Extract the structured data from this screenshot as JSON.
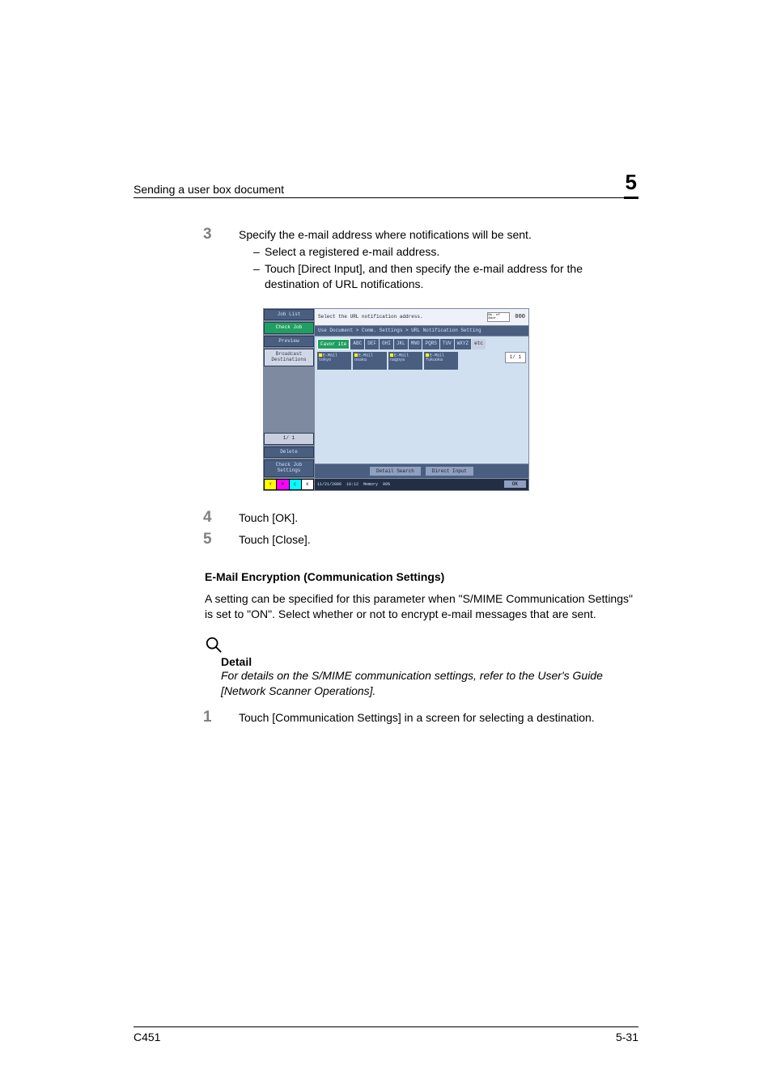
{
  "header": {
    "section_title": "Sending a user box document",
    "chapter_number": "5"
  },
  "steps": {
    "s3": {
      "num": "3",
      "text": "Specify the e-mail address where notifications will be sent.",
      "sub1": "Select a registered e-mail address.",
      "sub2": "Touch [Direct Input], and then specify the e-mail address for the destination of URL notifications."
    },
    "s4": {
      "num": "4",
      "text": "Touch [OK]."
    },
    "s5": {
      "num": "5",
      "text": "Touch [Close]."
    },
    "s1b": {
      "num": "1",
      "text": "Touch [Communication Settings] in a screen for selecting a destination."
    }
  },
  "encryption": {
    "heading": "E-Mail Encryption (Communication Settings)",
    "para": "A setting can be specified for this parameter when \"S/MIME Communication Settings\" is set to \"ON\". Select whether or not to encrypt e-mail messages that are sent."
  },
  "detail": {
    "heading": "Detail",
    "body": "For details on the S/MIME communication settings, refer to the User's Guide [Network Scanner Operations]."
  },
  "footer": {
    "model": "C451",
    "pageno": "5-31"
  },
  "screenshot": {
    "side": {
      "job_list": "Job List",
      "check_job": "Check Job",
      "preview": "Preview",
      "broadcast": "Broadcast\nDestinations",
      "page_ind": "1/ 1",
      "delete": "Delete",
      "check_job_settings": "Check Job\nSettings",
      "ymck": {
        "y": "Y",
        "m": "M",
        "c": "C",
        "k": "K"
      }
    },
    "top": {
      "prompt": "Select the URL notification address.",
      "counter_label": "No. of\nAddr.",
      "counter_value": "000"
    },
    "breadcrumb": "Use Document > Comm. Settings > URL Notification Setting",
    "tabs": {
      "favorite": "Favor\nite",
      "abc": "ABC",
      "def": "DEF",
      "ghi": "GHI",
      "jkl": "JKL",
      "mno": "MNO",
      "pqrs": "PQRS",
      "tuv": "TUV",
      "wxyz": "WXYZ",
      "etc": "etc"
    },
    "cards": {
      "tokyo": {
        "l1": "E-Mail",
        "l2": "tokyo"
      },
      "osaka": {
        "l1": "E-Mail",
        "l2": "osaka"
      },
      "nagoya": {
        "l1": "E-Mail",
        "l2": "nagoya"
      },
      "fukuoka": {
        "l1": "E-Mail",
        "l2": "fukuoka"
      }
    },
    "page_ind_main": "1/ 1",
    "bottom": {
      "detail_search": "Detail Search",
      "direct_input": "Direct Input"
    },
    "status": {
      "date": "11/21/2006",
      "time": "18:12",
      "mem": "Memory",
      "mem_pct": "99%",
      "ok": "OK"
    }
  }
}
